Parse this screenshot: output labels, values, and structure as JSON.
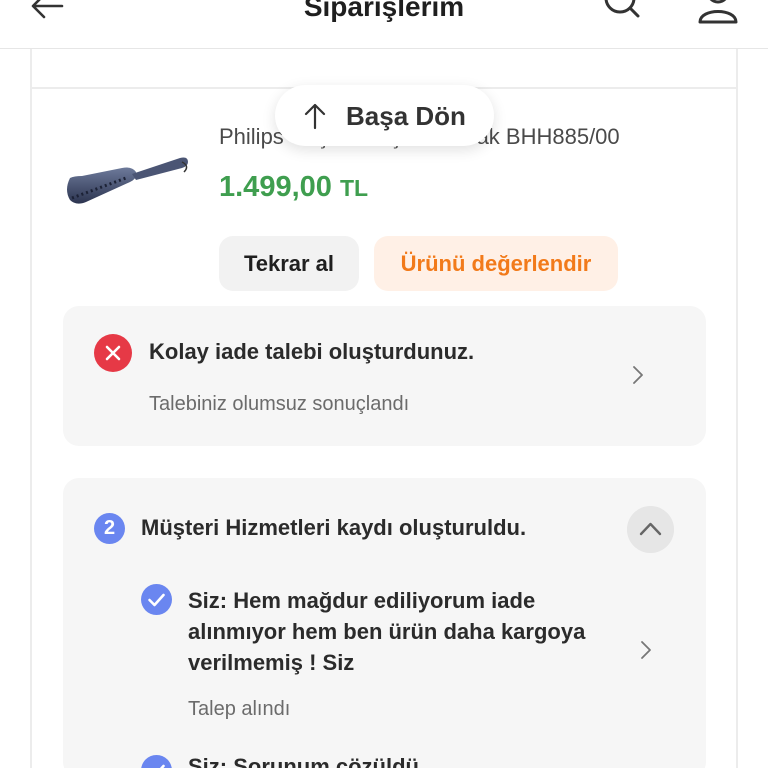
{
  "header": {
    "title": "Siparişlerim",
    "back_icon": "arrow-left-icon",
    "search_icon": "search-icon",
    "user_icon": "user-icon"
  },
  "scroll_top": {
    "label": "Başa Dön",
    "icon": "arrow-up-icon"
  },
  "product": {
    "name": "Philips Saç Düzleştirici Tarak BHH885/00",
    "price": "1.499,00",
    "currency": "TL",
    "price_color": "#3f9e4f"
  },
  "actions": {
    "buy_again": "Tekrar al",
    "rate_product": "Ürünü değerlendir",
    "accent": "#f27a1a"
  },
  "return_request": {
    "title": "Kolay iade talebi oluşturdunuz.",
    "status": "Talebiniz olumsuz sonuçlandı",
    "status_icon": "close-icon",
    "status_color": "#e63946"
  },
  "support_record": {
    "badge": "2",
    "title": "Müşteri Hizmetleri kaydı oluşturuldu.",
    "badge_color": "#6a86f0",
    "items": [
      {
        "text": "Siz: Hem mağdur ediliyorum iade alınmıyor hem ben ürün daha kargoya verilmemiş ! Siz",
        "status": "Talep alındı"
      },
      {
        "text": "Siz: Sorunum çözüldü",
        "status": ""
      }
    ]
  }
}
